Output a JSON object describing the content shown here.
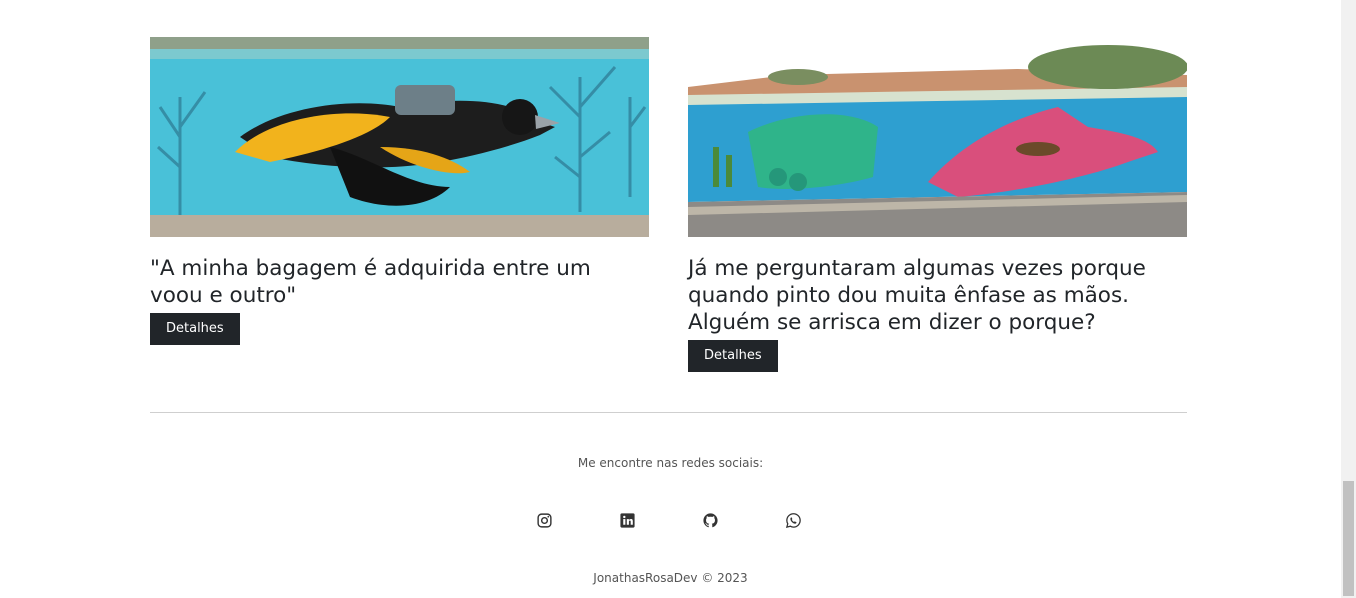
{
  "cards": [
    {
      "title": "\"A minha bagagem é adquirida entre um voou e outro\"",
      "button_label": "Detalhes",
      "image_alt": "mural-bird"
    },
    {
      "title": "Já me perguntaram algumas vezes porque quando pinto dou muita ênfase as mãos. Alguém se arrisca em dizer o porque?",
      "button_label": "Detalhes",
      "image_alt": "mural-hands"
    }
  ],
  "footer": {
    "caption": "Me encontre nas redes sociais:",
    "socials": [
      {
        "icon": "instagram-icon"
      },
      {
        "icon": "linkedin-icon"
      },
      {
        "icon": "github-icon"
      },
      {
        "icon": "whatsapp-icon"
      }
    ],
    "copyright": "JonathasRosaDev © 2023"
  },
  "colors": {
    "button_bg": "#212529",
    "text": "#212529",
    "divider": "#cfcfcf"
  }
}
